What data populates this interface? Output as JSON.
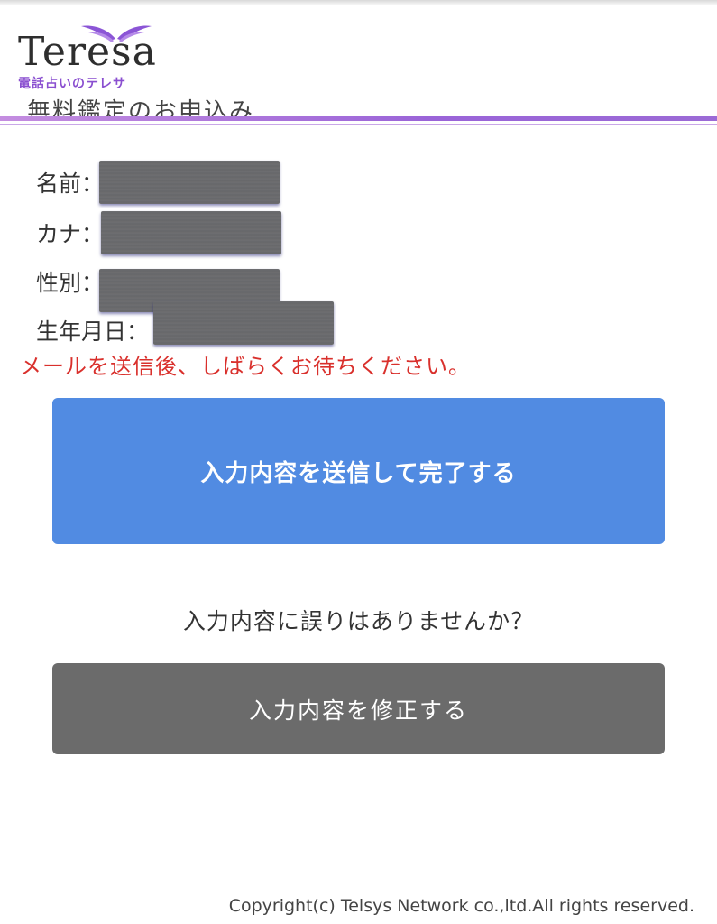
{
  "header": {
    "logo_word": "Teresa",
    "logo_sub": "電話占いのテレサ",
    "cut_heading": "無料鑑定のお申込み"
  },
  "fields": [
    {
      "label": "名前："
    },
    {
      "label": "カナ："
    },
    {
      "label": "性別："
    },
    {
      "label": "生年月日："
    }
  ],
  "notice": "メールを送信後、しばらくお待ちください。",
  "submit_button": {
    "label": "入力内容を送信して完了する"
  },
  "question": "入力内容に誤りはありませんか？",
  "edit_button": {
    "label": "入力内容を修正する"
  },
  "footer": {
    "copyright": "Copyright(c) Telsys Network co.,ltd.All rights reserved."
  },
  "colors": {
    "accent_purple": "#9a64d8",
    "submit_blue": "#518be2",
    "edit_gray": "#6b6b6b",
    "notice_red": "#d9302c"
  }
}
